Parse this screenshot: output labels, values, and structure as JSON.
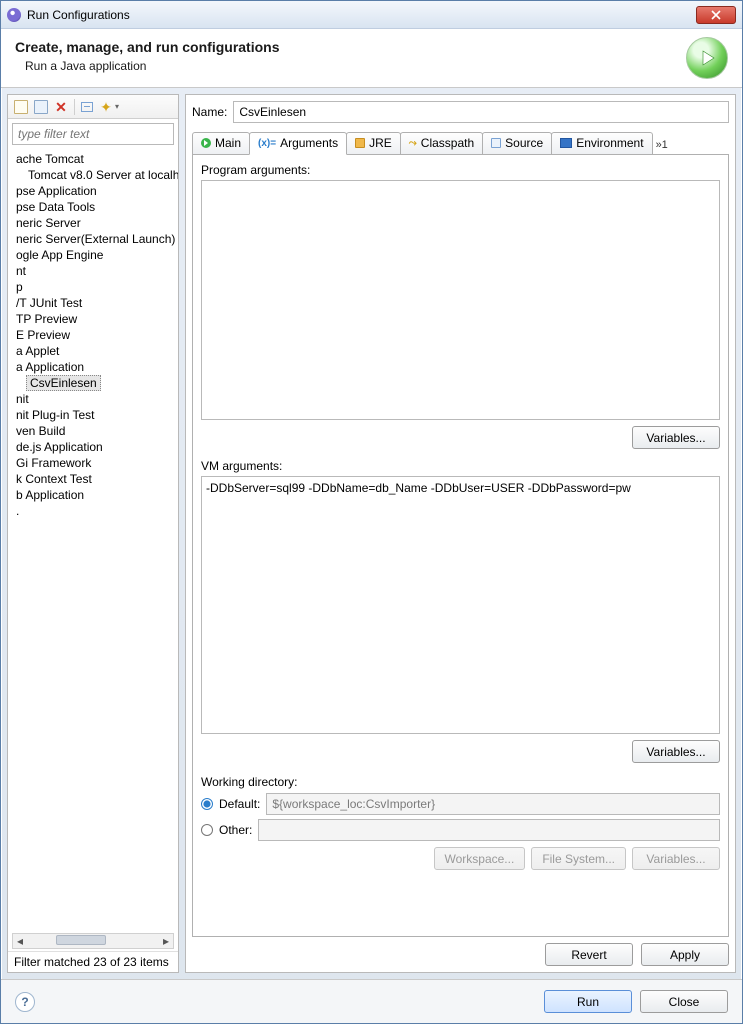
{
  "window": {
    "title": "Run Configurations"
  },
  "header": {
    "heading": "Create, manage, and run configurations",
    "subtitle": "Run a Java application"
  },
  "left": {
    "filter_placeholder": "type filter text",
    "items": [
      {
        "label": "ache Tomcat"
      },
      {
        "label": "Tomcat v8.0 Server at localho",
        "sub": true
      },
      {
        "label": "pse Application"
      },
      {
        "label": "pse Data Tools"
      },
      {
        "label": "neric Server"
      },
      {
        "label": "neric Server(External Launch)"
      },
      {
        "label": "ogle App Engine"
      },
      {
        "label": "nt"
      },
      {
        "label": "p"
      },
      {
        "label": "/T JUnit Test"
      },
      {
        "label": "TP Preview"
      },
      {
        "label": "E Preview"
      },
      {
        "label": "a Applet"
      },
      {
        "label": "a Application"
      },
      {
        "label": "CsvEinlesen",
        "sub": true,
        "selected": true
      },
      {
        "label": "nit"
      },
      {
        "label": "nit Plug-in Test"
      },
      {
        "label": "ven Build"
      },
      {
        "label": "de.js Application"
      },
      {
        "label": "Gi Framework"
      },
      {
        "label": "k Context Test"
      },
      {
        "label": "b Application"
      },
      {
        "label": "."
      }
    ],
    "status": "Filter matched 23 of 23 items"
  },
  "right": {
    "name_label": "Name:",
    "name_value": "CsvEinlesen",
    "tabs": {
      "main": "Main",
      "arguments": "Arguments",
      "jre": "JRE",
      "classpath": "Classpath",
      "source": "Source",
      "environment": "Environment",
      "overflow": "»1"
    },
    "args_panel": {
      "program_label": "Program arguments:",
      "program_value": "",
      "vm_label": "VM arguments:",
      "vm_value": "-DDbServer=sql99 -DDbName=db_Name -DDbUser=USER -DDbPassword=pw",
      "variables_button": "Variables...",
      "working_dir_label": "Working directory:",
      "default_label": "Default:",
      "default_value": "${workspace_loc:CsvImporter}",
      "other_label": "Other:",
      "other_value": "",
      "workspace_button": "Workspace...",
      "filesystem_button": "File System...",
      "variables_button2": "Variables..."
    },
    "actions": {
      "revert": "Revert",
      "apply": "Apply"
    }
  },
  "bottom": {
    "run": "Run",
    "close": "Close"
  }
}
